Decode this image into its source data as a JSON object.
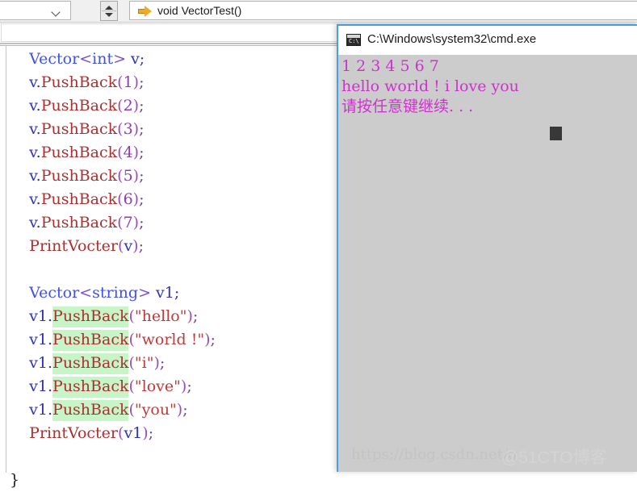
{
  "ide": {
    "scope_combo_value": ":",
    "member_combo_value": "void VectorTest()",
    "method_icon": "orange-arrow-icon",
    "chevron_icon": "chevron-down-icon",
    "spinner_up_icon": "spinner-up-arrow-icon",
    "spinner_down_icon": "spinner-down-arrow-icon"
  },
  "code": {
    "lines": [
      {
        "id": "line-vector-int",
        "tokens": [
          {
            "text": "    ",
            "cls": "t-punc"
          },
          {
            "text": "Vector",
            "cls": "t-type"
          },
          {
            "text": "<",
            "cls": "t-angle"
          },
          {
            "text": "int",
            "cls": "t-inner"
          },
          {
            "text": ">",
            "cls": "t-angle"
          },
          {
            "text": " v;",
            "cls": "t-var"
          }
        ]
      },
      {
        "id": "line-push-1",
        "tokens": [
          {
            "text": "    v.",
            "cls": "t-var"
          },
          {
            "text": "PushBack",
            "cls": "t-fn"
          },
          {
            "text": "(",
            "cls": "t-paren"
          },
          {
            "text": "1",
            "cls": "t-num"
          },
          {
            "text": ")",
            "cls": "t-paren"
          },
          {
            "text": ";",
            "cls": "t-punc"
          }
        ]
      },
      {
        "id": "line-push-2",
        "tokens": [
          {
            "text": "    v.",
            "cls": "t-var"
          },
          {
            "text": "PushBack",
            "cls": "t-fn"
          },
          {
            "text": "(",
            "cls": "t-paren"
          },
          {
            "text": "2",
            "cls": "t-num"
          },
          {
            "text": ")",
            "cls": "t-paren"
          },
          {
            "text": ";",
            "cls": "t-punc"
          }
        ]
      },
      {
        "id": "line-push-3",
        "tokens": [
          {
            "text": "    v.",
            "cls": "t-var"
          },
          {
            "text": "PushBack",
            "cls": "t-fn"
          },
          {
            "text": "(",
            "cls": "t-paren"
          },
          {
            "text": "3",
            "cls": "t-num"
          },
          {
            "text": ")",
            "cls": "t-paren"
          },
          {
            "text": ";",
            "cls": "t-punc"
          }
        ]
      },
      {
        "id": "line-push-4",
        "tokens": [
          {
            "text": "    v.",
            "cls": "t-var"
          },
          {
            "text": "PushBack",
            "cls": "t-fn"
          },
          {
            "text": "(",
            "cls": "t-paren"
          },
          {
            "text": "4",
            "cls": "t-num"
          },
          {
            "text": ")",
            "cls": "t-paren"
          },
          {
            "text": ";",
            "cls": "t-punc"
          }
        ]
      },
      {
        "id": "line-push-5",
        "tokens": [
          {
            "text": "    v.",
            "cls": "t-var"
          },
          {
            "text": "PushBack",
            "cls": "t-fn"
          },
          {
            "text": "(",
            "cls": "t-paren"
          },
          {
            "text": "5",
            "cls": "t-num"
          },
          {
            "text": ")",
            "cls": "t-paren"
          },
          {
            "text": ";",
            "cls": "t-punc"
          }
        ]
      },
      {
        "id": "line-push-6",
        "tokens": [
          {
            "text": "    v.",
            "cls": "t-var"
          },
          {
            "text": "PushBack",
            "cls": "t-fn"
          },
          {
            "text": "(",
            "cls": "t-paren"
          },
          {
            "text": "6",
            "cls": "t-num"
          },
          {
            "text": ")",
            "cls": "t-paren"
          },
          {
            "text": ";",
            "cls": "t-punc"
          }
        ]
      },
      {
        "id": "line-push-7",
        "tokens": [
          {
            "text": "    v.",
            "cls": "t-var"
          },
          {
            "text": "PushBack",
            "cls": "t-fn"
          },
          {
            "text": "(",
            "cls": "t-paren"
          },
          {
            "text": "7",
            "cls": "t-num"
          },
          {
            "text": ")",
            "cls": "t-paren"
          },
          {
            "text": ";",
            "cls": "t-punc"
          }
        ]
      },
      {
        "id": "line-print-v",
        "tokens": [
          {
            "text": "    ",
            "cls": "t-punc"
          },
          {
            "text": "PrintVocter",
            "cls": "t-fn"
          },
          {
            "text": "(",
            "cls": "t-paren"
          },
          {
            "text": "v",
            "cls": "t-var"
          },
          {
            "text": ")",
            "cls": "t-paren"
          },
          {
            "text": ";",
            "cls": "t-punc"
          }
        ]
      },
      {
        "id": "line-blank-1",
        "tokens": []
      },
      {
        "id": "line-vector-string",
        "tokens": [
          {
            "text": "    ",
            "cls": "t-punc"
          },
          {
            "text": "Vector",
            "cls": "t-type"
          },
          {
            "text": "<",
            "cls": "t-angle"
          },
          {
            "text": "string",
            "cls": "t-inner"
          },
          {
            "text": ">",
            "cls": "t-angle"
          },
          {
            "text": " v1;",
            "cls": "t-var"
          }
        ]
      },
      {
        "id": "line-push-hello",
        "tokens": [
          {
            "text": "    v1.",
            "cls": "t-var"
          },
          {
            "text": "PushBack",
            "cls": "t-fn sel"
          },
          {
            "text": "(",
            "cls": "t-paren"
          },
          {
            "text": "\"hello\"",
            "cls": "t-str"
          },
          {
            "text": ")",
            "cls": "t-paren"
          },
          {
            "text": ";",
            "cls": "t-punc"
          }
        ]
      },
      {
        "id": "line-push-world",
        "tokens": [
          {
            "text": "    v1.",
            "cls": "t-var"
          },
          {
            "text": "PushBack",
            "cls": "t-fn sel"
          },
          {
            "text": "(",
            "cls": "t-paren"
          },
          {
            "text": "\"world !\"",
            "cls": "t-str"
          },
          {
            "text": ")",
            "cls": "t-paren"
          },
          {
            "text": ";",
            "cls": "t-punc"
          }
        ]
      },
      {
        "id": "line-push-i",
        "tokens": [
          {
            "text": "    v1.",
            "cls": "t-var"
          },
          {
            "text": "PushBack",
            "cls": "t-fn sel"
          },
          {
            "text": "(",
            "cls": "t-paren"
          },
          {
            "text": "\"i\"",
            "cls": "t-str"
          },
          {
            "text": ")",
            "cls": "t-paren"
          },
          {
            "text": ";",
            "cls": "t-punc"
          }
        ]
      },
      {
        "id": "line-push-love",
        "tokens": [
          {
            "text": "    v1.",
            "cls": "t-var"
          },
          {
            "text": "PushBack",
            "cls": "t-fn sel"
          },
          {
            "text": "(",
            "cls": "t-paren"
          },
          {
            "text": "\"love\"",
            "cls": "t-str"
          },
          {
            "text": ")",
            "cls": "t-paren"
          },
          {
            "text": ";",
            "cls": "t-punc"
          }
        ]
      },
      {
        "id": "line-push-you",
        "tokens": [
          {
            "text": "    v1.",
            "cls": "t-var"
          },
          {
            "text": "PushBack",
            "cls": "t-fn sel"
          },
          {
            "text": "(",
            "cls": "t-paren"
          },
          {
            "text": "\"you\"",
            "cls": "t-str"
          },
          {
            "text": ")",
            "cls": "t-paren"
          },
          {
            "text": ";",
            "cls": "t-punc"
          }
        ]
      },
      {
        "id": "line-print-v1",
        "tokens": [
          {
            "text": "    ",
            "cls": "t-punc"
          },
          {
            "text": "PrintVocter",
            "cls": "t-fn"
          },
          {
            "text": "(",
            "cls": "t-paren"
          },
          {
            "text": "v1",
            "cls": "t-var"
          },
          {
            "text": ")",
            "cls": "t-paren"
          },
          {
            "text": ";",
            "cls": "t-punc"
          }
        ]
      },
      {
        "id": "line-blank-2",
        "tokens": []
      },
      {
        "id": "line-close-brace",
        "tokens": [
          {
            "text": "}",
            "cls": "t-brace"
          }
        ]
      }
    ]
  },
  "console": {
    "title": "C:\\Windows\\system32\\cmd.exe",
    "icon": "cmd-window-icon",
    "output_lines": [
      "1 2 3 4 5 6 7",
      "hello world ! i love you",
      "请按任意键继续. . ."
    ],
    "cursor": "block-cursor",
    "background_color": "#cccccc",
    "text_color": "#cc33cc"
  },
  "watermark": {
    "url": "https://blog.csdn.net/q",
    "brand": "@51CTO博客"
  }
}
